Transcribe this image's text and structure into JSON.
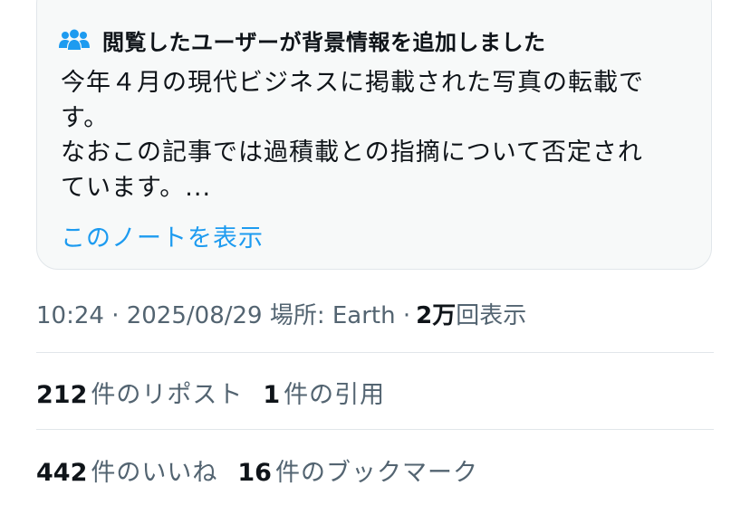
{
  "note": {
    "title": "閲覧したユーザーが背景情報を追加しました",
    "body_lines": [
      "今年４月の現代ビジネスに掲載された写真の転載で",
      "す。",
      "なおこの記事では過積載との指摘について否定され",
      "ています。..."
    ],
    "show_note_label": "このノートを表示",
    "icon": "people-icon",
    "accent_color": "#1d9bf0"
  },
  "meta": {
    "prefix": "10:24 · 2025/08/29 場所: Earth ·",
    "views_count": "2万",
    "views_label": "回表示"
  },
  "stats": {
    "reposts": {
      "count": "212",
      "label": "件のリポスト"
    },
    "quotes": {
      "count": "1",
      "label": "件の引用"
    },
    "likes": {
      "count": "442",
      "label": "件のいいね"
    },
    "bookmarks": {
      "count": "16",
      "label": "件のブックマーク"
    }
  }
}
